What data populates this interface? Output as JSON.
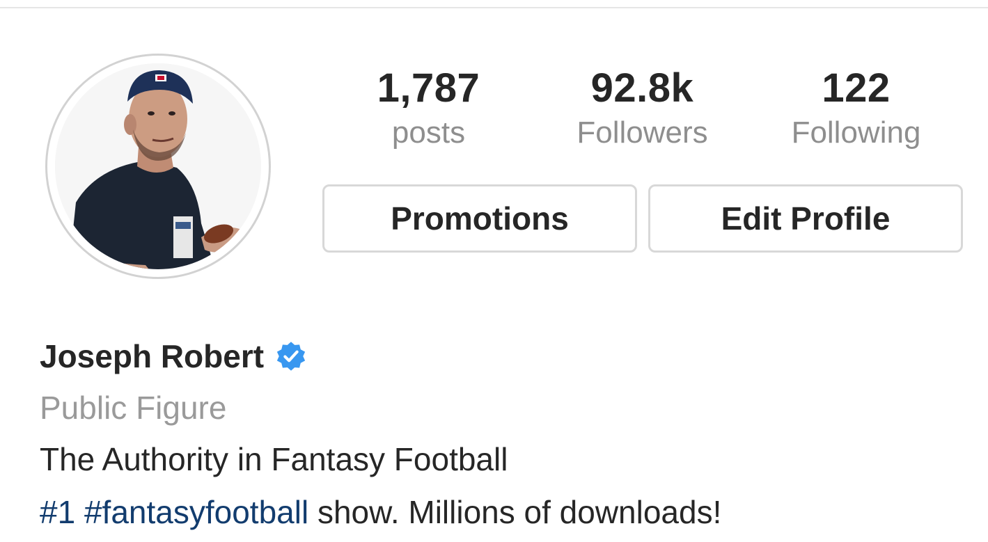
{
  "profile": {
    "avatar_icon": "profile-photo",
    "stats": {
      "posts": {
        "value": "1,787",
        "label": "posts"
      },
      "followers": {
        "value": "92.8k",
        "label": "Followers"
      },
      "following": {
        "value": "122",
        "label": "Following"
      }
    },
    "buttons": {
      "promotions": "Promotions",
      "edit_profile": "Edit Profile"
    },
    "name": "Joseph Robert",
    "verified_icon": "verified-badge-icon",
    "verified_color": "#3897f0",
    "category": "Public Figure",
    "bio": {
      "line1": "The Authority in Fantasy Football",
      "hashtag1": "#1",
      "hashtag2": "#fantasyfootball",
      "line2_rest": " show. Millions of downloads!"
    }
  },
  "colors": {
    "text": "#262626",
    "muted": "#8e8e8e",
    "hashtag": "#123c6e",
    "border": "#d8d8d8"
  }
}
